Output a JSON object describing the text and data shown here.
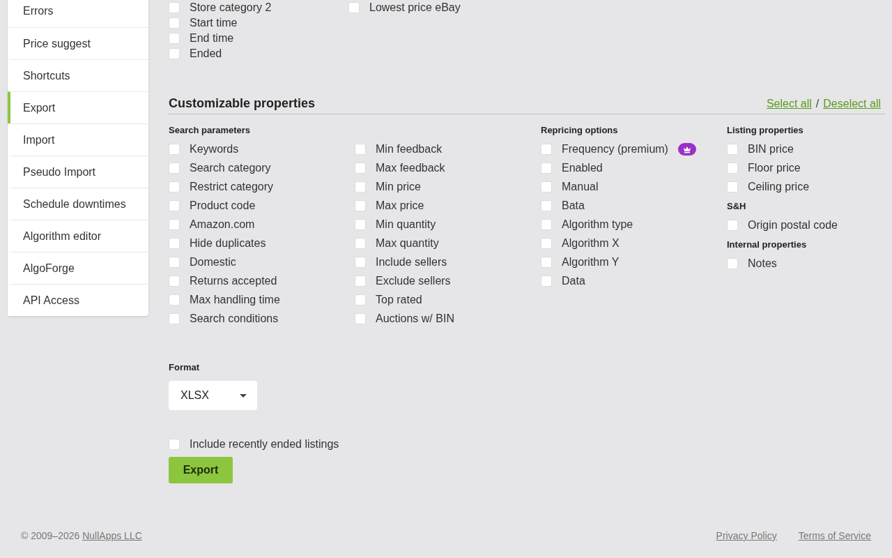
{
  "sidebar": {
    "items": [
      {
        "label": "Errors",
        "selected": false
      },
      {
        "label": "Price suggest",
        "selected": false
      },
      {
        "label": "Shortcuts",
        "selected": false
      },
      {
        "label": "Export",
        "selected": true
      },
      {
        "label": "Import",
        "selected": false
      },
      {
        "label": "Pseudo Import",
        "selected": false
      },
      {
        "label": "Schedule downtimes",
        "selected": false
      },
      {
        "label": "Algorithm editor",
        "selected": false
      },
      {
        "label": "AlgoForge",
        "selected": false
      },
      {
        "label": "API Access",
        "selected": false
      }
    ]
  },
  "standard_properties": {
    "columns": [
      [
        {
          "label": "Store category 2",
          "checked": false
        },
        {
          "label": "Start time",
          "checked": false
        },
        {
          "label": "End time",
          "checked": false
        },
        {
          "label": "Ended",
          "checked": false
        }
      ],
      [
        {
          "label": "Lowest price eBay",
          "checked": false
        }
      ]
    ]
  },
  "customizable_properties": {
    "title": "Customizable properties",
    "select_all": "Select all",
    "separator": "/",
    "deselect_all": "Deselect all",
    "stacks": [
      [
        {
          "title": "Search parameters",
          "columns": [
            [
              {
                "label": "Keywords",
                "checked": false
              },
              {
                "label": "Search category",
                "checked": false
              },
              {
                "label": "Restrict category",
                "checked": false
              },
              {
                "label": "Product code",
                "checked": false
              },
              {
                "label": "Amazon.com",
                "checked": false
              },
              {
                "label": "Hide duplicates",
                "checked": false
              },
              {
                "label": "Domestic",
                "checked": false
              },
              {
                "label": "Returns accepted",
                "checked": false
              },
              {
                "label": "Max handling time",
                "checked": false
              },
              {
                "label": "Search conditions",
                "checked": false
              }
            ],
            [
              {
                "label": "Min feedback",
                "checked": false
              },
              {
                "label": "Max feedback",
                "checked": false
              },
              {
                "label": "Min price",
                "checked": false
              },
              {
                "label": "Max price",
                "checked": false
              },
              {
                "label": "Min quantity",
                "checked": false
              },
              {
                "label": "Max quantity",
                "checked": false
              },
              {
                "label": "Include sellers",
                "checked": false
              },
              {
                "label": "Exclude sellers",
                "checked": false
              },
              {
                "label": "Top rated",
                "checked": false
              },
              {
                "label": "Auctions w/ BIN",
                "checked": false
              }
            ]
          ]
        }
      ],
      [
        {
          "title": "Repricing options",
          "columns": [
            [
              {
                "label": "Frequency (premium)",
                "checked": false,
                "premium": true
              },
              {
                "label": "Enabled",
                "checked": false
              },
              {
                "label": "Manual",
                "checked": false
              },
              {
                "label": "Bata",
                "checked": false
              },
              {
                "label": "Algorithm type",
                "checked": false
              },
              {
                "label": "Algorithm X",
                "checked": false
              },
              {
                "label": "Algorithm Y",
                "checked": false
              },
              {
                "label": "Data",
                "checked": false
              }
            ]
          ]
        }
      ],
      [
        {
          "title": "Listing properties",
          "columns": [
            [
              {
                "label": "BIN price",
                "checked": false
              },
              {
                "label": "Floor price",
                "checked": false
              },
              {
                "label": "Ceiling price",
                "checked": false
              }
            ]
          ]
        },
        {
          "title": "S&H",
          "columns": [
            [
              {
                "label": "Origin postal code",
                "checked": false
              }
            ]
          ]
        },
        {
          "title": "Internal properties",
          "columns": [
            [
              {
                "label": "Notes",
                "checked": false
              }
            ]
          ]
        }
      ]
    ]
  },
  "format": {
    "label": "Format",
    "value": "XLSX"
  },
  "include_recently_ended": {
    "label": "Include recently ended listings",
    "checked": false
  },
  "export_button": {
    "label": "Export"
  },
  "footer": {
    "copyright": "© 2009–2026",
    "company_link": "NullApps LLC",
    "links": [
      "Privacy Policy",
      "Terms of Service"
    ]
  }
}
